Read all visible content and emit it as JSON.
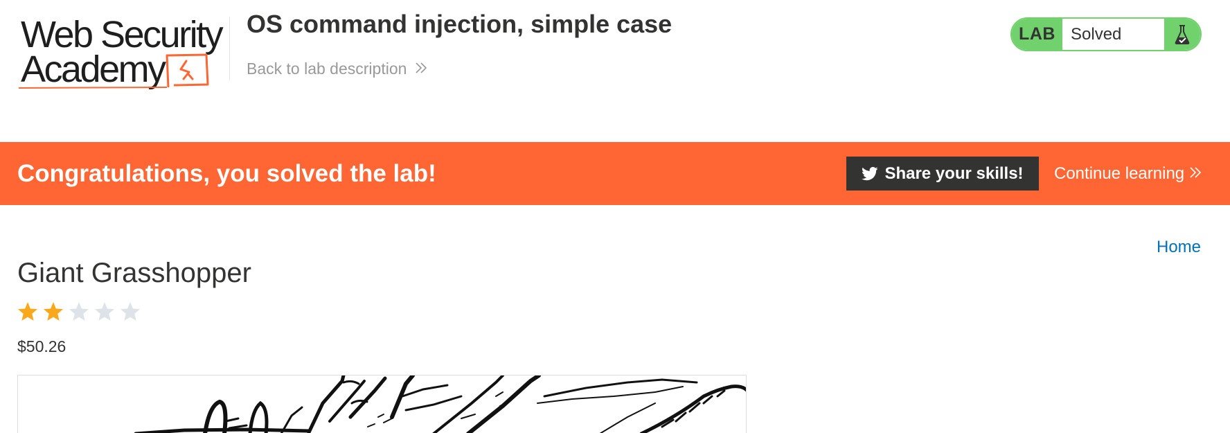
{
  "header": {
    "logo": {
      "line1": "Web Security",
      "line2": "Academy",
      "name": "Web Security Academy"
    },
    "lab_title": "OS command injection, simple case",
    "back_link": "Back to lab description",
    "status": {
      "tag": "LAB",
      "state": "Solved",
      "icon": "flask-check-icon",
      "color": "#70d16d"
    }
  },
  "banner": {
    "message": "Congratulations, you solved the lab!",
    "share_label": "Share your skills!",
    "share_icon": "twitter-icon",
    "continue_label": "Continue learning",
    "background": "#ff6633"
  },
  "nav": {
    "home": "Home"
  },
  "product": {
    "title": "Giant Grasshopper",
    "rating": {
      "value": 2,
      "max": 5
    },
    "price": "$50.26",
    "image_icon": "grasshopper-sketch-image"
  },
  "colors": {
    "accent_orange": "#ff6633",
    "solved_green": "#70d16d",
    "link_blue": "#0071bc",
    "star_filled": "#f9a81c",
    "star_empty": "#dde3e8"
  }
}
